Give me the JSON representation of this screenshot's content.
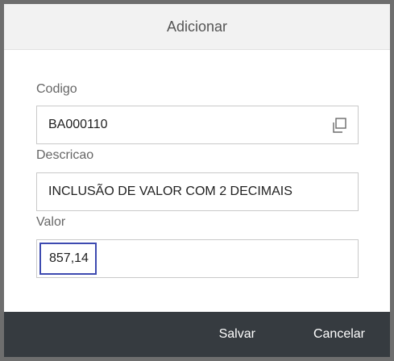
{
  "dialog": {
    "title": "Adicionar"
  },
  "fields": {
    "codigo": {
      "label": "Codigo",
      "value": "BA000110",
      "icon": "copy-icon"
    },
    "descricao": {
      "label": "Descricao",
      "value": "INCLUSÃO DE VALOR COM 2 DECIMAIS"
    },
    "valor": {
      "label": "Valor",
      "value": "857,14"
    }
  },
  "footer": {
    "save_label": "Salvar",
    "cancel_label": "Cancelar"
  },
  "colors": {
    "header_bg": "#f2f2f2",
    "footer_bg": "#363b40",
    "focus_border": "#3d4ab0",
    "overlay": "#6e6e6e"
  }
}
